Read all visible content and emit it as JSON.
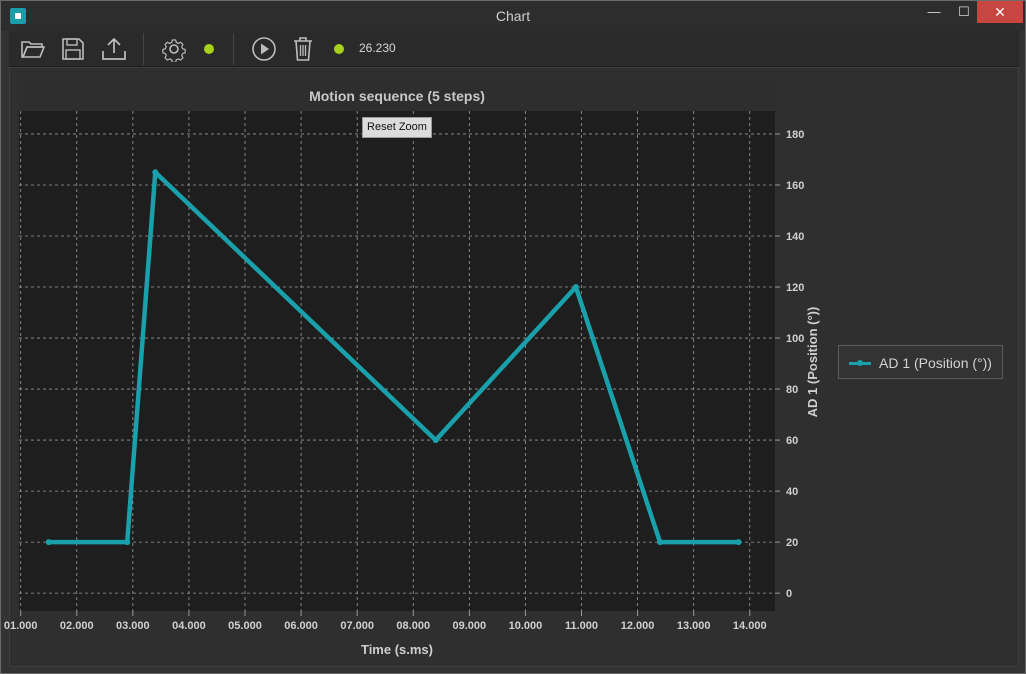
{
  "window": {
    "title": "Chart",
    "minimize": "—",
    "maximize": "☐",
    "close": "✕"
  },
  "toolbar": {
    "buttons": [
      {
        "name": "open-folder",
        "icon": "folder-open-icon"
      },
      {
        "name": "save",
        "icon": "floppy-disk-icon"
      },
      {
        "name": "export",
        "icon": "upload-icon"
      },
      {
        "name": "settings",
        "icon": "gear-icon"
      },
      {
        "name": "play",
        "icon": "play-circle-icon"
      },
      {
        "name": "delete",
        "icon": "trash-icon"
      }
    ],
    "status_color": "#a6d21a",
    "counter": "26.230"
  },
  "reset_zoom_label": "Reset Zoom",
  "chart_data": {
    "type": "line",
    "title": "Motion sequence (5 steps)",
    "xlabel": "Time (s.ms)",
    "ylabel": "AD 1 (Position (°))",
    "xlim": [
      0.97,
      14.45
    ],
    "ylim": [
      -7,
      189
    ],
    "x_ticks": [
      1,
      2,
      3,
      4,
      5,
      6,
      7,
      8,
      9,
      10,
      11,
      12,
      13,
      14
    ],
    "x_tick_labels": [
      "01.000",
      "02.000",
      "03.000",
      "04.000",
      "05.000",
      "06.000",
      "07.000",
      "08.000",
      "09.000",
      "10.000",
      "11.000",
      "12.000",
      "13.000",
      "14.000"
    ],
    "y_ticks": [
      0,
      20,
      40,
      60,
      80,
      100,
      120,
      140,
      160,
      180
    ],
    "y_tick_labels": [
      "0",
      "20",
      "40",
      "60",
      "80",
      "100",
      "120",
      "140",
      "160",
      "180"
    ],
    "grid": true,
    "legend_position": "right",
    "series": [
      {
        "name": "AD 1 (Position (°))",
        "color": "#1aa0ab",
        "x": [
          1.5,
          2.9,
          3.4,
          8.4,
          10.9,
          12.4,
          13.8
        ],
        "y": [
          20,
          20,
          165,
          60,
          120,
          20,
          20
        ]
      }
    ]
  }
}
